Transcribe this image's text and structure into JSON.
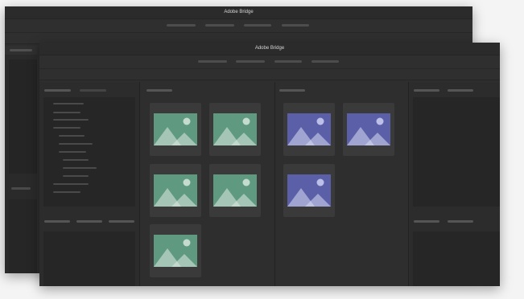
{
  "app": {
    "title": "Adobe Bridge"
  },
  "colors": {
    "green_thumb": "#5f9a80",
    "green_mountain": "#dfe9e2",
    "green_sun": "#cfe2d6",
    "blue_thumb": "#5b5fa8",
    "blue_mountain": "#d9dcf3",
    "blue_sun": "#c7cbef"
  },
  "thumbnails_green": [
    {
      "kind": "green"
    },
    {
      "kind": "green"
    },
    {
      "kind": "green"
    },
    {
      "kind": "green"
    },
    {
      "kind": "green"
    }
  ],
  "thumbnails_blue": [
    {
      "kind": "blue"
    },
    {
      "kind": "blue"
    },
    {
      "kind": "blue"
    }
  ]
}
